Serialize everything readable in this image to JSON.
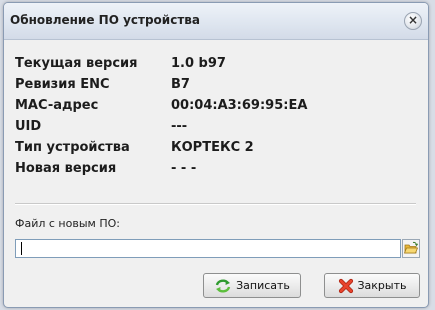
{
  "dialog": {
    "title": "Обновление ПО устройства",
    "close_glyph": "×"
  },
  "info": {
    "rows": [
      {
        "label": "Текущая версия",
        "value": "1.0 b97"
      },
      {
        "label": "Ревизия ENC",
        "value": "B7"
      },
      {
        "label": "MAC-адрес",
        "value": "00:04:A3:69:95:EA"
      },
      {
        "label": "UID",
        "value": "---"
      },
      {
        "label": "Тип устройства",
        "value": "КОРТЕКС 2"
      },
      {
        "label": "Новая версия",
        "value": "- - -"
      }
    ]
  },
  "file": {
    "label": "Файл с новым ПО:",
    "value": "",
    "browse_icon": "folder-open-icon"
  },
  "buttons": {
    "save_label": "Записать",
    "save_icon": "refresh-arrows-icon",
    "close_label": "Закрыть",
    "close_icon": "red-x-icon"
  },
  "colors": {
    "title_gradient_top": "#eef2f8",
    "window_bg": "#f0f0f0",
    "save_icon_green": "#3aa53a",
    "close_icon_red": "#e0341f",
    "folder_yellow": "#f2c94c"
  }
}
